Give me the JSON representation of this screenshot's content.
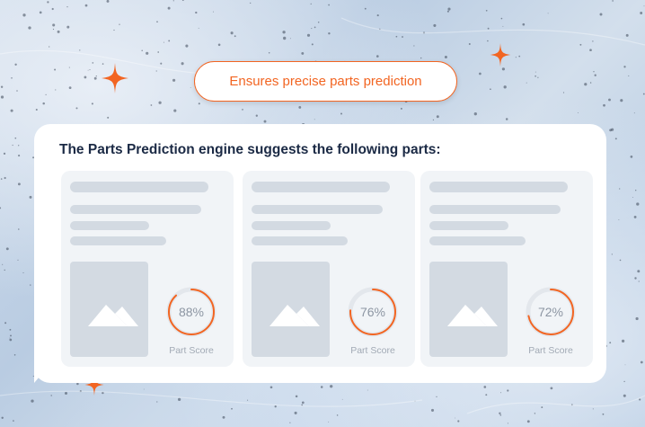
{
  "badge": {
    "label": "Ensures precise parts prediction"
  },
  "panel": {
    "title": "The Parts Prediction engine suggests the following parts:"
  },
  "cards": [
    {
      "score": "88%",
      "score_value": 88,
      "score_label": "Part Score"
    },
    {
      "score": "76%",
      "score_value": 76,
      "score_label": "Part Score"
    },
    {
      "score": "72%",
      "score_value": 72,
      "score_label": "Part Score"
    }
  ],
  "colors": {
    "accent": "#f26522",
    "title": "#1b2a45",
    "placeholder": "#d3dae2",
    "card_bg": "#f1f4f7",
    "ring_track": "#e3e7ec"
  },
  "icons": {
    "sparkle": "four-point-star-icon",
    "image_placeholder": "mountain-image-icon"
  }
}
